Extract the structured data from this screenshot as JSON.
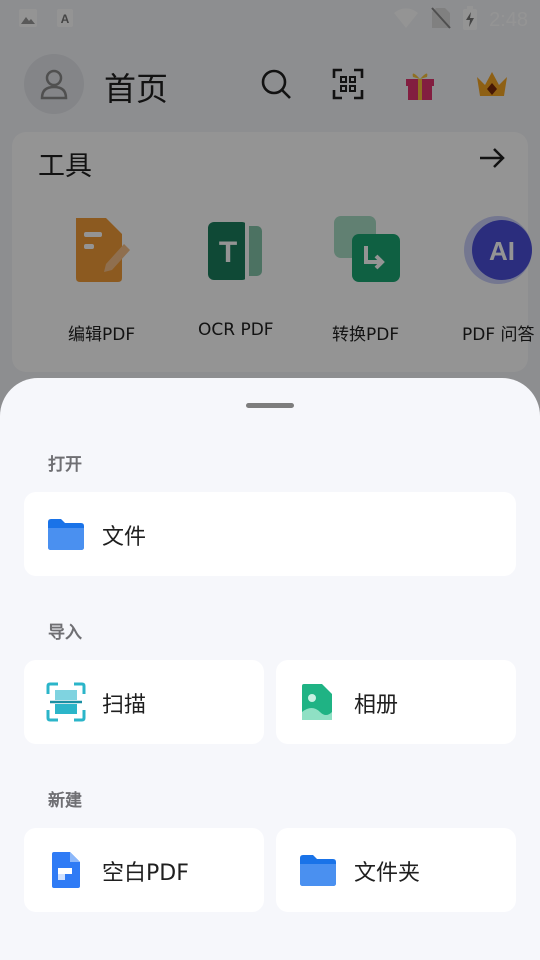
{
  "status_bar": {
    "time": "2:48",
    "icons": [
      "image-icon",
      "text-app-icon",
      "wifi-icon",
      "no-sim-icon",
      "battery-charging-icon"
    ]
  },
  "home": {
    "title": "首页",
    "header_icons": [
      "search-icon",
      "scan-qr-icon",
      "gift-icon",
      "crown-icon"
    ],
    "tools": {
      "title": "工具",
      "items": [
        {
          "label": "编辑PDF",
          "icon": "edit-pdf-icon",
          "color": "#f29c38"
        },
        {
          "label": "OCR PDF",
          "icon": "ocr-pdf-icon",
          "color": "#1b7f5e"
        },
        {
          "label": "转换PDF",
          "icon": "convert-pdf-icon",
          "color": "#1aa673"
        },
        {
          "label": "PDF 问答",
          "icon": "ai-icon",
          "color": "#4a4fd8"
        }
      ]
    }
  },
  "sheet": {
    "sections": [
      {
        "label": "打开",
        "items": [
          {
            "label": "文件",
            "icon": "folder-icon"
          }
        ]
      },
      {
        "label": "导入",
        "items": [
          {
            "label": "扫描",
            "icon": "scan-icon"
          },
          {
            "label": "相册",
            "icon": "album-icon"
          }
        ]
      },
      {
        "label": "新建",
        "items": [
          {
            "label": "空白PDF",
            "icon": "blank-pdf-icon"
          },
          {
            "label": "文件夹",
            "icon": "folder-icon"
          }
        ]
      }
    ]
  }
}
